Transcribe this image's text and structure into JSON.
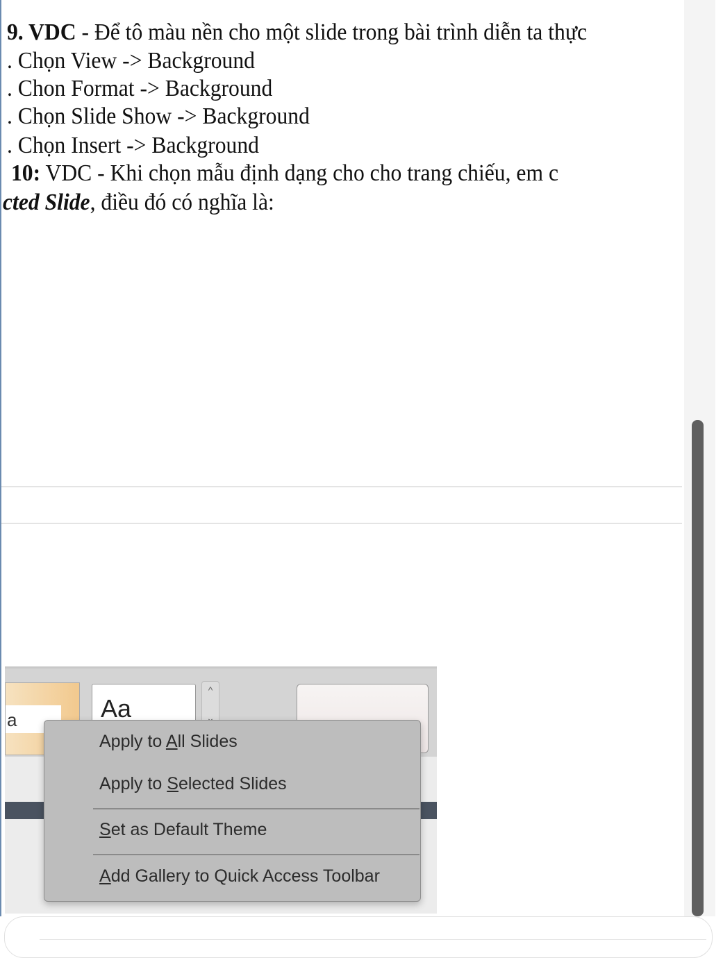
{
  "document": {
    "lines": [
      "9. VDC - Để tô màu nền cho một slide trong bài trình diễn ta thực",
      ". Chọn View -> Background",
      ". Chon Format -> Background",
      ". Chọn Slide Show -> Background",
      ". Chọn Insert -> Background",
      "10: VDC - Khi chọn mẫu định dạng cho cho trang chiếu, em c",
      "cted Slide, điều đó có nghĩa là:"
    ],
    "q9_prefix": "9. VDC",
    "q9_rest": " - Để tô màu nền cho một slide trong bài trình diễn ta thực",
    "q10_prefix": "10:",
    "q10_rest": " VDC - Khi chọn mẫu định dạng cho cho trang chiếu, em c",
    "q10_line2_italic": "cted Slide",
    "q10_line2_rest": ", điều đó có nghĩa là:"
  },
  "screenshot": {
    "theme_thumb_1": "a",
    "theme_thumb_2": "Aa",
    "scroll_up": "^",
    "scroll_down": "⌄",
    "context_menu": {
      "items": [
        {
          "pre": "Apply to ",
          "key": "A",
          "post": "ll Slides"
        },
        {
          "pre": "Apply to ",
          "key": "S",
          "post": "elected Slides"
        },
        {
          "pre": "",
          "key": "S",
          "post": "et as Default Theme"
        },
        {
          "pre": "",
          "key": "A",
          "post": "dd Gallery to Quick Access Toolbar"
        }
      ]
    }
  },
  "colors": {
    "menu_bg": "#bdbdbd",
    "scroll_thumb": "#5f5f5f"
  }
}
